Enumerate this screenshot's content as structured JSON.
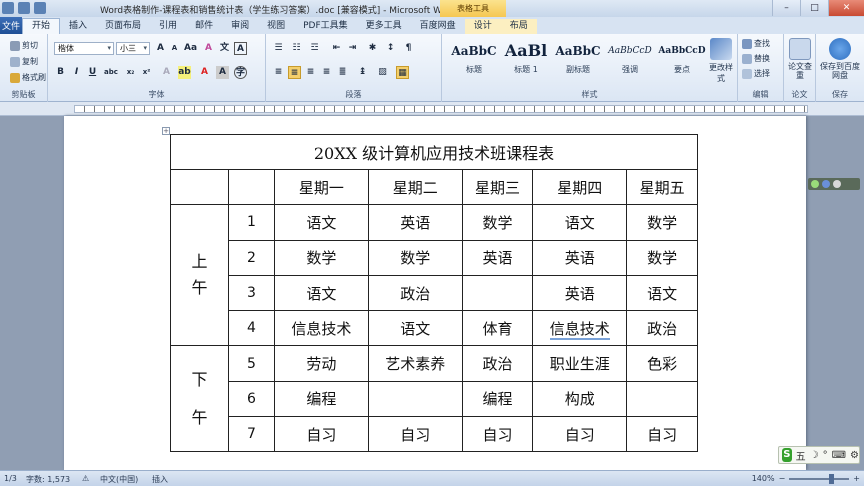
{
  "window": {
    "title": "Word表格制作-课程表和销售统计表（学生练习答案）.doc [兼容模式] - Microsoft Word",
    "contextual_tab_group": "表格工具"
  },
  "tabs": [
    "开始",
    "插入",
    "页面布局",
    "引用",
    "邮件",
    "审阅",
    "视图",
    "PDF工具集",
    "更多工具",
    "百度网盘",
    "设计",
    "布局"
  ],
  "file_tab": "文件",
  "ribbon": {
    "clipboard": {
      "label": "剪贴板",
      "cut": "剪切",
      "copy": "复制",
      "format_painter": "格式刷"
    },
    "font": {
      "label": "字体",
      "font_name": "楷体",
      "font_size": "小三"
    },
    "paragraph": {
      "label": "段落"
    },
    "styles": {
      "label": "样式",
      "items": [
        {
          "sample": "AaBbC",
          "name": "标题"
        },
        {
          "sample": "AaBl",
          "name": "标题 1"
        },
        {
          "sample": "AaBbC",
          "name": "副标题"
        },
        {
          "sample": "AaBbCcD",
          "name": "强调"
        },
        {
          "sample": "AaBbCcD",
          "name": "要点"
        }
      ],
      "change_styles": "更改样式"
    },
    "editing": {
      "label": "编辑",
      "find": "查找",
      "replace": "替换",
      "select": "选择"
    },
    "paper": {
      "label": "论文",
      "check": "论文查重"
    },
    "save": {
      "label": "保存",
      "save_to_baidu": "保存到百度网盘"
    }
  },
  "document": {
    "table_title": "20XX 级计算机应用技术班课程表",
    "days": [
      "星期一",
      "星期二",
      "星期三",
      "星期四",
      "星期五"
    ],
    "morning_label": [
      "上",
      "午"
    ],
    "afternoon_label": [
      "下",
      "午"
    ],
    "rows": [
      {
        "num": "1",
        "cells": [
          "语文",
          "英语",
          "数学",
          "语文",
          "数学"
        ]
      },
      {
        "num": "2",
        "cells": [
          "数学",
          "数学",
          "英语",
          "英语",
          "数学"
        ]
      },
      {
        "num": "3",
        "cells": [
          "语文",
          "政治",
          "",
          "英语",
          "语文"
        ]
      },
      {
        "num": "4",
        "cells": [
          "信息技术",
          "语文",
          "体育",
          "信息技术",
          "政治"
        ]
      },
      {
        "num": "5",
        "cells": [
          "劳动",
          "艺术素养",
          "政治",
          "职业生涯",
          "色彩"
        ]
      },
      {
        "num": "6",
        "cells": [
          "编程",
          "",
          "编程",
          "构成",
          ""
        ]
      },
      {
        "num": "7",
        "cells": [
          "自习",
          "自习",
          "自习",
          "自习",
          "自习"
        ]
      }
    ]
  },
  "statusbar": {
    "page": "1/3",
    "words": "字数: 1,573",
    "language": "中文(中国)",
    "mode": "插入",
    "zoom": "140%"
  },
  "ime": {
    "mode": "五"
  }
}
